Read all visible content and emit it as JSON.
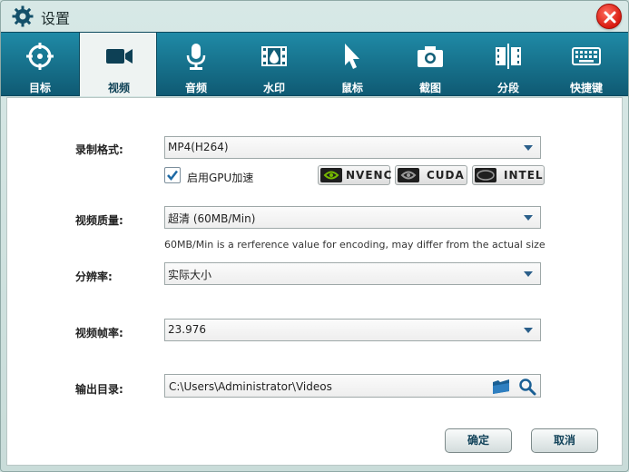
{
  "window": {
    "title": "设置"
  },
  "tabs": [
    {
      "id": "target",
      "label": "目标",
      "icon": "target-icon"
    },
    {
      "id": "video",
      "label": "视频",
      "icon": "video-camera-icon",
      "active": true
    },
    {
      "id": "audio",
      "label": "音频",
      "icon": "microphone-icon"
    },
    {
      "id": "watermark",
      "label": "水印",
      "icon": "film-drop-icon"
    },
    {
      "id": "mouse",
      "label": "鼠标",
      "icon": "cursor-icon"
    },
    {
      "id": "screenshot",
      "label": "截图",
      "icon": "camera-icon"
    },
    {
      "id": "segment",
      "label": "分段",
      "icon": "split-icon"
    },
    {
      "id": "hotkeys",
      "label": "快捷键",
      "icon": "keyboard-icon"
    }
  ],
  "format": {
    "label": "录制格式:",
    "value": "MP4(H264)"
  },
  "gpu": {
    "label": "启用GPU加速",
    "checked": true,
    "encoders": [
      "NVENC",
      "CUDA",
      "INTEL"
    ]
  },
  "quality": {
    "label": "视频质量:",
    "value": "超清 (60MB/Min)",
    "hint": "60MB/Min is a rerference value for encoding, may differ from the actual size"
  },
  "resolution": {
    "label": "分辨率:",
    "value": "实际大小"
  },
  "framerate": {
    "label": "视频帧率:",
    "value": "23.976"
  },
  "output": {
    "label": "输出目录:",
    "path": "C:\\Users\\Administrator\\Videos"
  },
  "buttons": {
    "ok": "确定",
    "cancel": "取消"
  },
  "colors": {
    "tabbar": "#1f8aa6",
    "close": "#d81a10",
    "accent": "#2b5f8a"
  }
}
